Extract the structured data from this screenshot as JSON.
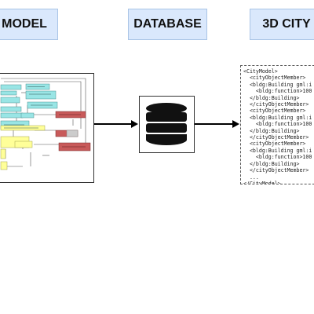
{
  "labels": {
    "model": "MODEL",
    "database": "DATABASE",
    "city": "3D CITY"
  },
  "colors": {
    "label_fill": "#dae8fc",
    "uml_cyan": "#99e5e5",
    "uml_yellow": "#ffff99",
    "uml_red": "#c85a5a",
    "uml_gray": "#cccccc",
    "database_icon": "#111111"
  },
  "icons": {
    "database": "database-icon",
    "uml": "uml-class-diagram"
  },
  "code_lines": [
    "<CityModel>",
    "  <cityObjectMember>",
    "  <bldg:Building gml:i",
    "    <bldg:function>100",
    "  </bldg:Building>",
    "  </cityObjectMember>",
    "  <cityObjectMember>",
    "  <bldg:Building gml:i",
    "    <bldg:function>100",
    "  </bldg:Building>",
    "  </cityObjectMember>",
    "  <cityObjectMember>",
    "  <bldg:Building gml:i",
    "    <bldg:function>100",
    "  </bldg:Building>",
    "  </cityObjectMember>",
    "  ...",
    "</CityModel>"
  ]
}
